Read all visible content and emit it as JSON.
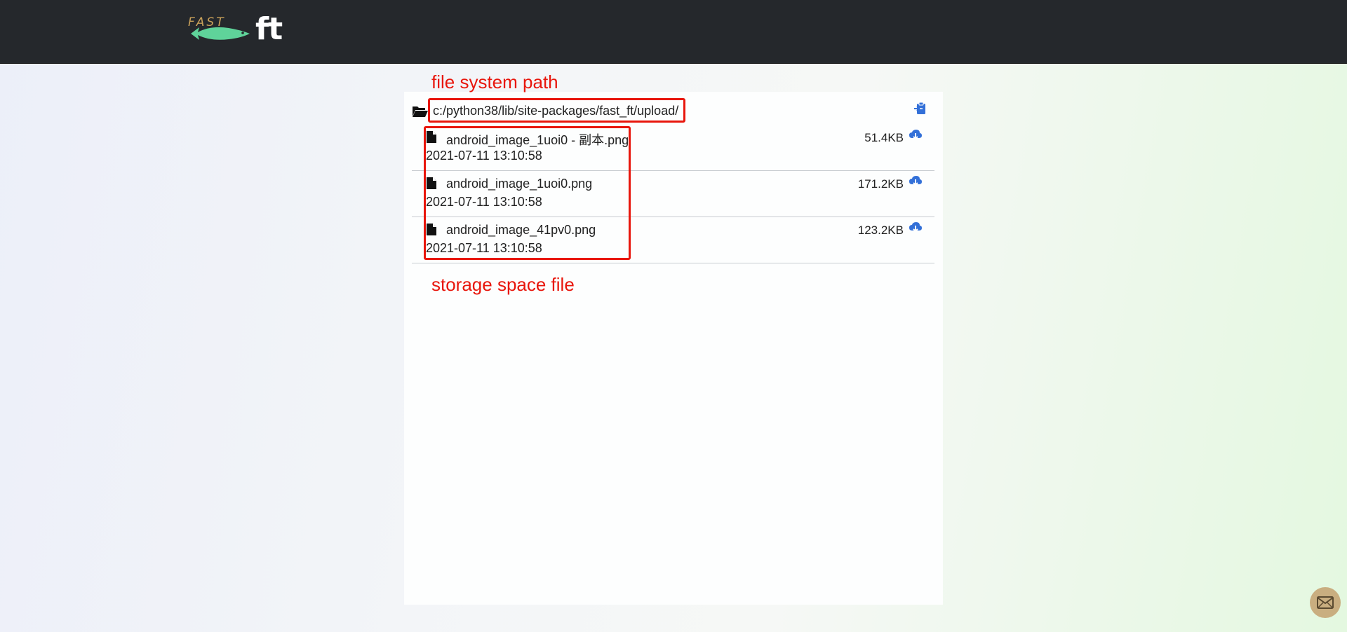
{
  "header": {
    "logo_prefix": "FAST",
    "logo_text": "ft"
  },
  "annotations": {
    "path_label": "file system path",
    "storage_label": "storage space file",
    "color": "#e8160c"
  },
  "path": {
    "value": "c:/python38/lib/site-packages/fast_ft/upload/",
    "folder_icon": "folder-open-icon",
    "copy_icon": "clipboard-icon"
  },
  "files": [
    {
      "name": "android_image_1uoi0 - 副本.png",
      "date": "2021-07-11 13:10:58",
      "size": "51.4KB",
      "icon": "file-icon",
      "action_icon": "cloud-download-icon"
    },
    {
      "name": "android_image_1uoi0.png",
      "date": "2021-07-11 13:10:58",
      "size": "171.2KB",
      "icon": "file-icon",
      "action_icon": "cloud-download-icon"
    },
    {
      "name": "android_image_41pv0.png",
      "date": "2021-07-11 13:10:58",
      "size": "123.2KB",
      "icon": "file-icon",
      "action_icon": "cloud-download-icon"
    }
  ],
  "mail": {
    "icon": "mail-icon"
  },
  "colors": {
    "topbar": "#25282c",
    "accent_blue": "#3370d8",
    "logo_gold": "#c9a15a",
    "fish_green": "#5fd39a",
    "mail_button": "#c9ae80"
  }
}
